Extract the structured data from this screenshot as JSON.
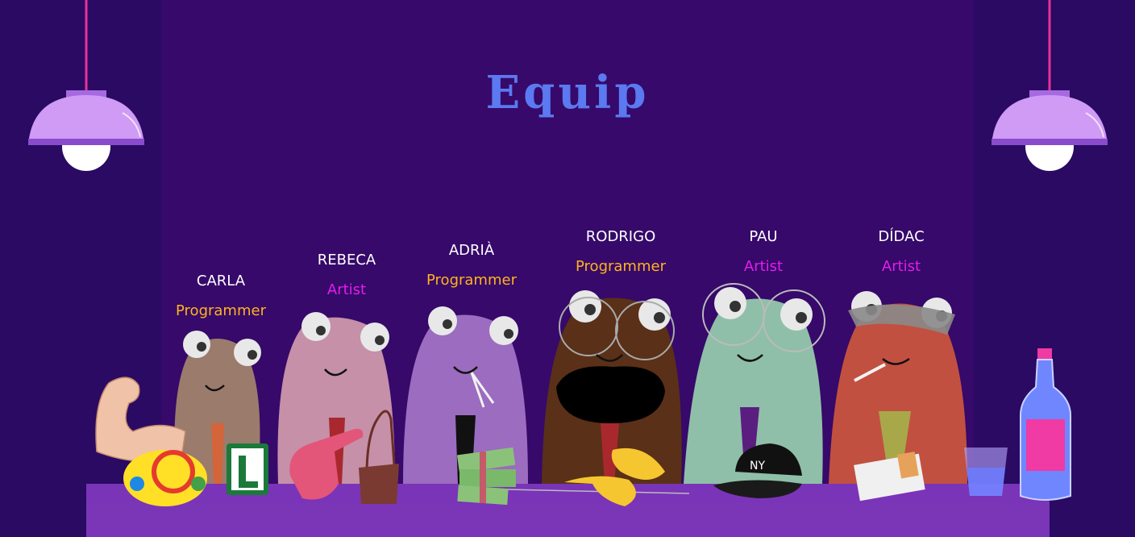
{
  "page": {
    "title": "Equip"
  },
  "colors": {
    "title": "#5b79f0",
    "programmer": "#ffb31f",
    "artist": "#e31dea",
    "name": "#ffffff",
    "background": "#2a0a63",
    "panel": "#36096a",
    "table": "#7a34b8"
  },
  "team": [
    {
      "name": "CARLA",
      "role": "Programmer",
      "role_color": "#ffb31f",
      "character_color": "#9b7b6b",
      "prop_icons": [
        "flexed-arm-icon",
        "toy-steering-wheel-icon",
        "l-plate-icon"
      ]
    },
    {
      "name": "REBECA",
      "role": "Artist",
      "role_color": "#e31dea",
      "character_color": "#c590a8",
      "prop_icons": [
        "foam-finger-icon",
        "handbag-icon"
      ]
    },
    {
      "name": "ADRIÀ",
      "role": "Programmer",
      "role_color": "#ffb31f",
      "character_color": "#9b6cc0",
      "prop_icons": [
        "cigarette-icon",
        "cash-stack-icon"
      ]
    },
    {
      "name": "RODRIGO",
      "role": "Programmer",
      "role_color": "#ffb31f",
      "character_color": "#5a3018",
      "prop_icons": [
        "round-glasses-icon",
        "beard-icon",
        "banana-icon"
      ]
    },
    {
      "name": "PAU",
      "role": "Artist",
      "role_color": "#e31dea",
      "character_color": "#8fbfa8",
      "prop_icons": [
        "round-glasses-icon",
        "baseball-cap-icon"
      ]
    },
    {
      "name": "DÍDAC",
      "role": "Artist",
      "role_color": "#e31dea",
      "character_color": "#c25040",
      "prop_icons": [
        "sunglasses-icon",
        "cigarette-icon",
        "cigarette-pack-icon"
      ]
    }
  ],
  "decor_icons": [
    "ceiling-lamp-icon",
    "bottle-icon",
    "glass-icon"
  ]
}
